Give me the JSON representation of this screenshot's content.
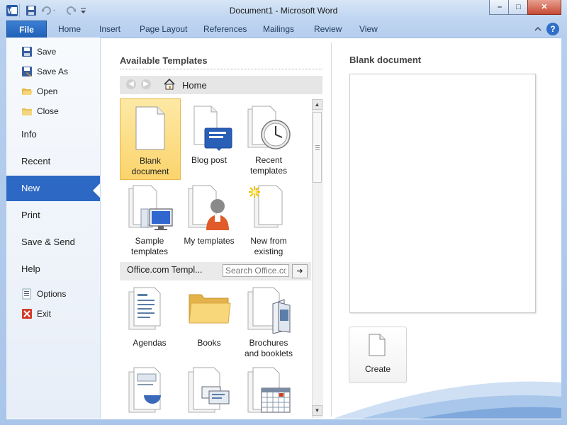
{
  "window": {
    "title": "Document1  -  Microsoft Word",
    "app_icon": "word-icon",
    "controls": {
      "minimize": "–",
      "maximize": "□",
      "close": "✕"
    }
  },
  "quick_access": [
    {
      "icon": "save-icon"
    },
    {
      "icon": "undo-icon"
    },
    {
      "icon": "redo-icon"
    },
    {
      "icon": "customize-dropdown-icon"
    }
  ],
  "ribbon": {
    "file_tab": "File",
    "tabs": [
      "Home",
      "Insert",
      "Page Layout",
      "References",
      "Mailings",
      "Review",
      "View"
    ],
    "help_icon": "?"
  },
  "backstage": {
    "nav_small_top": [
      {
        "label": "Save",
        "icon": "save-icon"
      },
      {
        "label": "Save As",
        "icon": "save-as-icon"
      },
      {
        "label": "Open",
        "icon": "open-folder-icon"
      },
      {
        "label": "Close",
        "icon": "close-folder-icon"
      }
    ],
    "nav_big": [
      "Info",
      "Recent",
      "New",
      "Print",
      "Save & Send",
      "Help"
    ],
    "nav_selected": "New",
    "nav_small_bottom": [
      {
        "label": "Options",
        "icon": "options-icon"
      },
      {
        "label": "Exit",
        "icon": "exit-icon"
      }
    ]
  },
  "templates": {
    "heading": "Available Templates",
    "breadcrumb": "Home",
    "items": [
      {
        "line1": "Blank",
        "line2": "document",
        "icon": "blank-document-icon",
        "selected": true
      },
      {
        "line1": "Blog post",
        "line2": "",
        "icon": "blog-post-icon"
      },
      {
        "line1": "Recent",
        "line2": "templates",
        "icon": "recent-templates-icon"
      },
      {
        "line1": "Sample",
        "line2": "templates",
        "icon": "sample-templates-icon"
      },
      {
        "line1": "My templates",
        "line2": "",
        "icon": "my-templates-icon"
      },
      {
        "line1": "New from",
        "line2": "existing",
        "icon": "new-from-existing-icon"
      }
    ],
    "office_section": {
      "label": "Office.com Templ...",
      "search_placeholder": "Search Office.com",
      "go": "➜"
    },
    "office_items": [
      {
        "line1": "Agendas",
        "line2": "",
        "icon": "agendas-icon"
      },
      {
        "line1": "Books",
        "line2": "",
        "icon": "books-folder-icon"
      },
      {
        "line1": "Brochures",
        "line2": "and booklets",
        "icon": "brochures-icon"
      },
      {
        "line1": "",
        "line2": "",
        "icon": "calendar-doc-icon"
      },
      {
        "line1": "",
        "line2": "",
        "icon": "cards-doc-icon"
      },
      {
        "line1": "",
        "line2": "",
        "icon": "calendar-icon"
      }
    ]
  },
  "preview": {
    "heading": "Blank document",
    "create_label": "Create"
  }
}
